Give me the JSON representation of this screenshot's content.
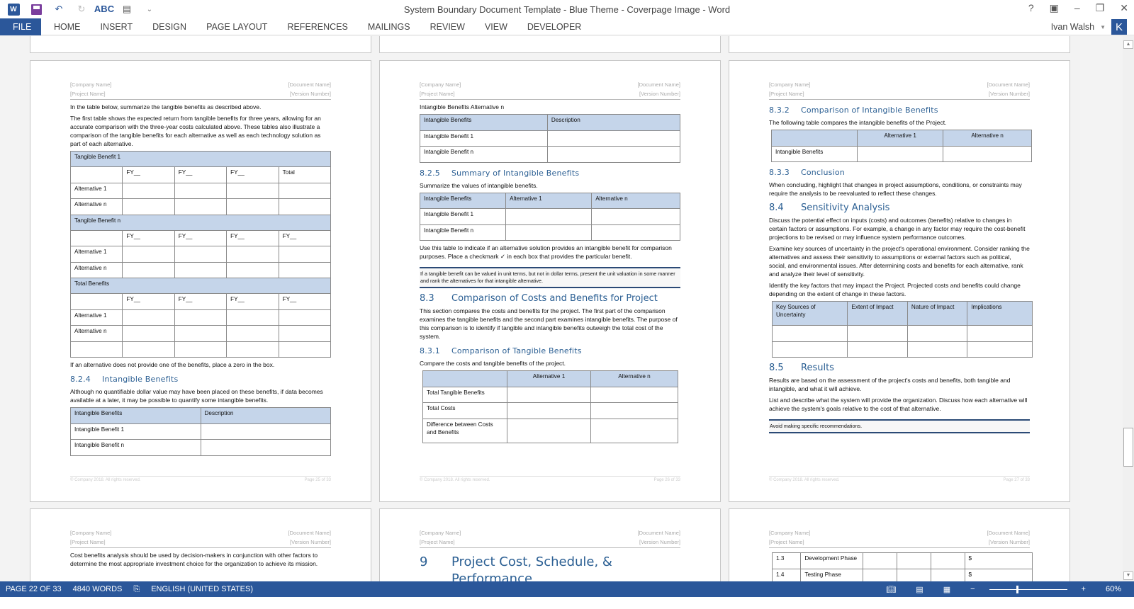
{
  "app": {
    "title": "System Boundary Document Template - Blue Theme - Coverpage Image - Word",
    "user": "Ivan Walsh",
    "avatar_letter": "K",
    "help": "?",
    "qat": {
      "word_logo": "W",
      "undo": "↶",
      "redo": "↻",
      "spell": "ABC",
      "more": "⌄"
    }
  },
  "ribbon": {
    "tabs": [
      "FILE",
      "HOME",
      "INSERT",
      "DESIGN",
      "PAGE LAYOUT",
      "REFERENCES",
      "MAILINGS",
      "REVIEW",
      "VIEW",
      "DEVELOPER"
    ]
  },
  "header": {
    "company": "[Company Name]",
    "document": "[Document Name]",
    "project": "[Project Name]",
    "version": "[Version Number]"
  },
  "footer": {
    "copyright": "© Company 2018. All rights reserved.",
    "page25": "Page 25 of 33",
    "page26": "Page 26 of 33",
    "page27": "Page 27 of 33"
  },
  "page1": {
    "intro1": "In the table below, summarize the tangible benefits as described above.",
    "intro2": "The first table shows the expected return from tangible benefits for three years, allowing for an accurate comparison with the three-year costs calculated above. These tables also illustrate a comparison of the tangible benefits for each alternative as well as each technology solution as part of each alternative.",
    "tangible_table": {
      "section1": "Tangible Benefit 1",
      "section2": "Tangible Benefit n",
      "section3": "Total Benefits",
      "fy": "FY__",
      "total": "Total",
      "alt1": "Alternative 1",
      "altn": "Alternative n"
    },
    "zero_note": "If an alternative does not provide one of the benefits, place a zero in the box.",
    "h_824_num": "8.2.4",
    "h_824": "Intangible Benefits",
    "p_824": "Although no quantifiable dollar value may have been placed on these benefits, if data becomes available at a later, it may be possible to quantify some intangible benefits.",
    "intangible_table": {
      "col1": "Intangible Benefits",
      "col2": "Description",
      "row1": "Intangible Benefit 1",
      "rown": "Intangible Benefit n"
    }
  },
  "page2": {
    "caption": "Intangible Benefits Alternative n",
    "table1": {
      "col1": "Intangible Benefits",
      "col2": "Description",
      "row1": "Intangible Benefit 1",
      "rown": "Intangible Benefit n"
    },
    "h_825_num": "8.2.5",
    "h_825": "Summary of Intangible Benefits",
    "p_825": "Summarize the values of intangible benefits.",
    "table2": {
      "col1": "Intangible Benefits",
      "col2": "Alternative 1",
      "col3": "Alternative n",
      "row1": "Intangible Benefit 1",
      "rown": "Intangible Benefit n"
    },
    "p_check": "Use this table to indicate if an alternative solution provides an intangible benefit for comparison purposes. Place a checkmark ✓ in each box that provides the particular benefit.",
    "note": "If a tangible benefit can be valued in unit terms, but not in dollar terms, present the unit valuation in some manner and rank the alternatives for that intangible alternative.",
    "h_83_num": "8.3",
    "h_83": "Comparison of Costs and Benefits for Project",
    "p_83": "This section compares the costs and benefits for the project. The first part of the comparison examines the tangible benefits and the second part examines intangible benefits. The purpose of this comparison is to identify if tangible and intangible benefits outweigh the total cost of the system.",
    "h_831_num": "8.3.1",
    "h_831": "Comparison of Tangible Benefits",
    "p_831": "Compare the costs and tangible benefits of the project.",
    "table3": {
      "col2": "Alternative 1",
      "col3": "Alternative n",
      "row1": "Total Tangible Benefits",
      "row2": "Total Costs",
      "row3": "Difference between Costs and Benefits"
    }
  },
  "page3": {
    "h_832_num": "8.3.2",
    "h_832": "Comparison of Intangible Benefits",
    "p_832": "The following table compares the intangible benefits of the Project.",
    "table1": {
      "col2": "Alternative 1",
      "col3": "Alternative n",
      "row1": "Intangible Benefits"
    },
    "h_833_num": "8.3.3",
    "h_833": "Conclusion",
    "p_833": "When concluding, highlight that changes in project assumptions, conditions, or constraints may require the analysis to be reevaluated to reflect these changes.",
    "h_84_num": "8.4",
    "h_84": "Sensitivity Analysis",
    "p_84a": "Discuss the potential effect on inputs (costs) and outcomes (benefits) relative to changes in certain factors or assumptions. For example, a change in any factor may require the cost-benefit projections to be revised or may influence system performance outcomes.",
    "p_84b": "Examine key sources of uncertainty in the project's operational environment. Consider ranking the alternatives and assess their sensitivity to assumptions or external factors such as political, social, and environmental issues. After determining costs and benefits for each alternative, rank and analyze their level of sensitivity.",
    "p_84c": "Identify the key factors that may impact the Project. Projected costs and benefits could change depending on the extent of change in these factors.",
    "table2": {
      "col1": "Key Sources of Uncertainty",
      "col2": "Extent of Impact",
      "col3": "Nature of Impact",
      "col4": "Implications"
    },
    "h_85_num": "8.5",
    "h_85": "Results",
    "p_85a": "Results are based on the assessment of the project's costs and benefits, both tangible and intangible, and what it will achieve.",
    "p_85b": "List and describe what the system will provide the organization. Discuss how each alternative will achieve the system's goals relative to the cost of that alternative.",
    "note": "Avoid making specific recommendations."
  },
  "page4": {
    "p1": "Cost benefits analysis should be used by decision-makers in conjunction with other factors to determine the most appropriate investment choice for the organization to achieve its mission."
  },
  "page5": {
    "h_9_num": "9",
    "h_9": "Project Cost, Schedule, & Performance"
  },
  "page6": {
    "rows": [
      {
        "id": "1.3",
        "phase": "Development Phase",
        "cost": "$"
      },
      {
        "id": "1.4",
        "phase": "Testing Phase",
        "cost": "$"
      }
    ]
  },
  "status": {
    "page": "PAGE 22 OF 33",
    "words": "4840 WORDS",
    "language": "ENGLISH (UNITED STATES)",
    "zoom_minus": "−",
    "zoom_plus": "+",
    "zoom": "60%"
  }
}
